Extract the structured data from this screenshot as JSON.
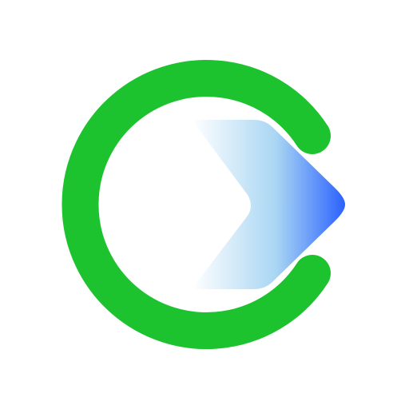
{
  "logo": {
    "ring_color": "#1DC22F",
    "arrow_gradient": {
      "start": "#ffffff",
      "mid": "#A9D6F3",
      "end": "#2B62FF"
    },
    "ring_icon": "green-c-ring-icon",
    "arrow_icon": "blue-play-arrow-icon"
  }
}
